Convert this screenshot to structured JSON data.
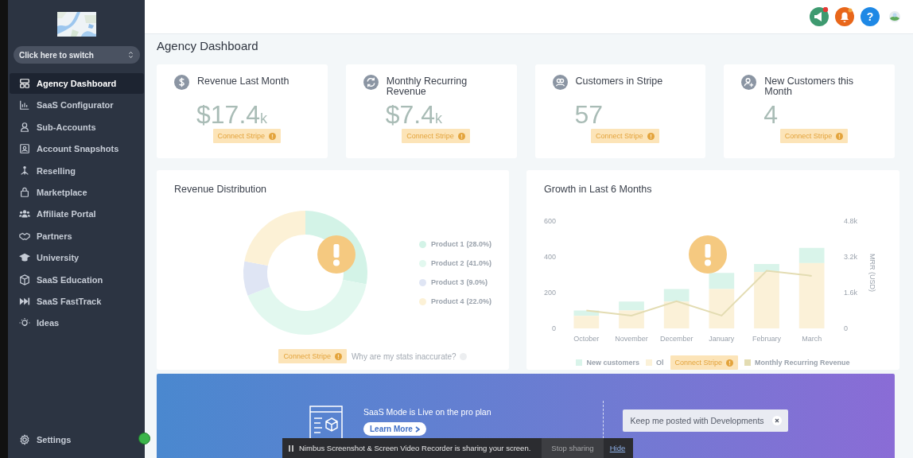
{
  "sidebar": {
    "switcher": {
      "label": "Click here to switch"
    },
    "items": [
      {
        "label": "Agency Dashboard",
        "selected": true
      },
      {
        "label": "SaaS Configurator",
        "selected": false
      },
      {
        "label": "Sub-Accounts",
        "selected": false
      },
      {
        "label": "Account Snapshots",
        "selected": false
      },
      {
        "label": "Reselling",
        "selected": false
      },
      {
        "label": "Marketplace",
        "selected": false
      },
      {
        "label": "Affiliate Portal",
        "selected": false
      },
      {
        "label": "Partners",
        "selected": false
      },
      {
        "label": "University",
        "selected": false
      },
      {
        "label": "SaaS Education",
        "selected": false
      },
      {
        "label": "SaaS FastTrack",
        "selected": false
      },
      {
        "label": "Ideas",
        "selected": false
      }
    ],
    "settings": {
      "label": "Settings",
      "selected": false
    }
  },
  "header": {
    "help_label": "?"
  },
  "page_title": "Agency Dashboard",
  "stats": [
    {
      "title": "Revenue Last Month",
      "value": "$17.4",
      "unit": "k",
      "action": "Connect Stripe"
    },
    {
      "title": "Monthly Recurring Revenue",
      "value": "$7.4",
      "unit": "k",
      "action": "Connect Stripe"
    },
    {
      "title": "Customers in Stripe",
      "value": "57",
      "action": "Connect Stripe"
    },
    {
      "title": "New Customers this Month",
      "value": "4",
      "action": "Connect Stripe"
    }
  ],
  "revenue_distribution": {
    "title": "Revenue Distribution",
    "legend": [
      {
        "percent": "(28.0%)",
        "color": "#d3f3e7"
      },
      {
        "percent": "(41.0%)",
        "color": "#e2f8ef"
      },
      {
        "percent": "(9.0%)",
        "color": "#dfe5f4"
      },
      {
        "percent": "(22.0%)",
        "color": "#fcf1d6"
      }
    ],
    "chart_data": {
      "type": "donut",
      "categories": [
        "Product 1",
        "Product 2",
        "Product 3",
        "Product 4"
      ],
      "values": [
        28,
        41,
        9,
        22
      ]
    },
    "action": "Connect Stripe",
    "help_link": "Why are my stats inaccurate?"
  },
  "growth": {
    "title": "Growth in Last 6 Months",
    "action": "Connect Stripe",
    "chart_data": {
      "type": "bar",
      "stacked": true,
      "ylim": [
        0,
        600
      ],
      "y2lim": [
        0,
        4800
      ],
      "y2label": "MRR (USD)",
      "y2ticks": [
        {
          "value": 4800,
          "label": "4.8k"
        },
        {
          "value": 3200,
          "label": "3.2k"
        },
        {
          "value": 1600,
          "label": "1.6k"
        },
        {
          "value": 0,
          "label": "0"
        }
      ],
      "categories": [
        "October",
        "November",
        "December",
        "January",
        "February",
        "March"
      ],
      "yticks": [
        0,
        200,
        400,
        600
      ],
      "series": [
        {
          "name": "New customers",
          "color": "#d9f4ea",
          "values": [
            30,
            50,
            70,
            90,
            45,
            85
          ]
        },
        {
          "name": "Ol",
          "color": "#fbf1d8",
          "values": [
            70,
            100,
            150,
            220,
            315,
            365
          ]
        },
        {
          "name": "Monthly Recurring Revenue",
          "type": "line",
          "axis": "y2",
          "color": "#e3dcb2",
          "values": [
            800,
            570,
            1220,
            570,
            2580,
            2350
          ]
        }
      ]
    }
  },
  "banner": {
    "text": "SaaS Mode is Live on the pro plan",
    "button": "Learn More",
    "notice": "Keep me posted with Developments"
  },
  "share_bar": {
    "text": "Nimbus Screenshot & Screen Video Recorder is sharing your screen.",
    "stop": "Stop sharing",
    "hide": "Hide"
  }
}
